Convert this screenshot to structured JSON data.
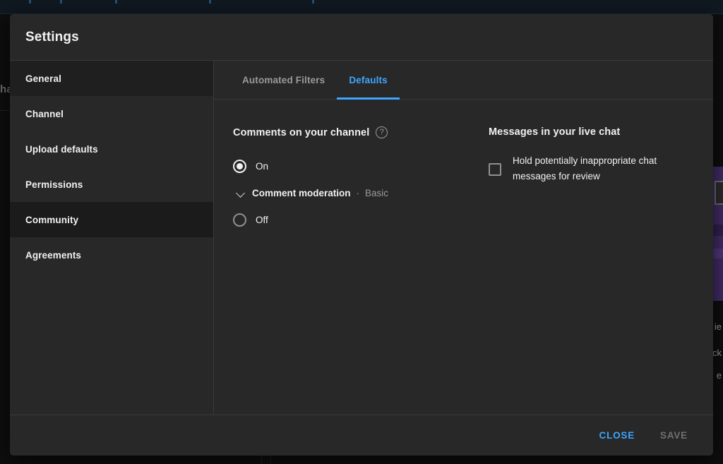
{
  "background": {
    "left_text": "ha",
    "right_texts": [
      "ie",
      "ck",
      "e"
    ],
    "accent_purple": "#3f2a63",
    "topbar_color": "#101820"
  },
  "modal": {
    "title": "Settings",
    "sidebar": {
      "items": [
        {
          "label": "General",
          "state": "hovered"
        },
        {
          "label": "Channel",
          "state": "normal"
        },
        {
          "label": "Upload defaults",
          "state": "normal"
        },
        {
          "label": "Permissions",
          "state": "normal"
        },
        {
          "label": "Community",
          "state": "selected"
        },
        {
          "label": "Agreements",
          "state": "normal"
        }
      ]
    },
    "tabs": [
      {
        "label": "Automated Filters",
        "active": false
      },
      {
        "label": "Defaults",
        "active": true
      }
    ],
    "panel": {
      "comments": {
        "heading": "Comments on your channel",
        "help_icon": "help-circle-icon",
        "help_glyph": "?",
        "options": [
          {
            "label": "On",
            "checked": true
          },
          {
            "label": "Off",
            "checked": false
          }
        ],
        "moderation": {
          "chevron_icon": "chevron-down-icon",
          "label": "Comment moderation",
          "separator": "·",
          "value": "Basic"
        }
      },
      "live_chat": {
        "heading": "Messages in your live chat",
        "checkbox": {
          "label": "Hold potentially inappropriate chat messages for review",
          "checked": false
        }
      }
    },
    "footer": {
      "close_label": "CLOSE",
      "save_label": "SAVE",
      "accent_color": "#3ea6ff"
    }
  }
}
